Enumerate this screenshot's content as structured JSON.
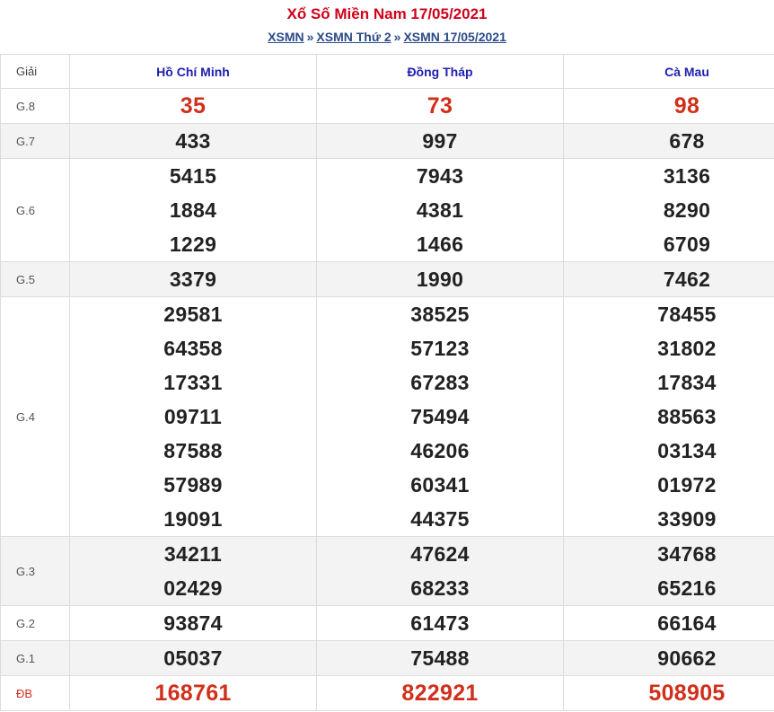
{
  "header": {
    "title": "Xổ Số Miền Nam 17/05/2021",
    "breadcrumb": [
      "XSMN",
      "XSMN Thứ 2",
      "XSMN 17/05/2021"
    ],
    "separator": "»"
  },
  "table": {
    "label_header": "Giải",
    "provinces": [
      "Hồ Chí Minh",
      "Đồng Tháp",
      "Cà Mau"
    ],
    "rows": [
      {
        "label": "G.8",
        "style": "red",
        "alt": false,
        "results": [
          [
            "35"
          ],
          [
            "73"
          ],
          [
            "98"
          ]
        ]
      },
      {
        "label": "G.7",
        "style": "normal",
        "alt": true,
        "results": [
          [
            "433"
          ],
          [
            "997"
          ],
          [
            "678"
          ]
        ]
      },
      {
        "label": "G.6",
        "style": "normal",
        "alt": false,
        "results": [
          [
            "5415",
            "1884",
            "1229"
          ],
          [
            "7943",
            "4381",
            "1466"
          ],
          [
            "3136",
            "8290",
            "6709"
          ]
        ]
      },
      {
        "label": "G.5",
        "style": "normal",
        "alt": true,
        "results": [
          [
            "3379"
          ],
          [
            "1990"
          ],
          [
            "7462"
          ]
        ]
      },
      {
        "label": "G.4",
        "style": "normal",
        "alt": false,
        "results": [
          [
            "29581",
            "64358",
            "17331",
            "09711",
            "87588",
            "57989",
            "19091"
          ],
          [
            "38525",
            "57123",
            "67283",
            "75494",
            "46206",
            "60341",
            "44375"
          ],
          [
            "78455",
            "31802",
            "17834",
            "88563",
            "03134",
            "01972",
            "33909"
          ]
        ]
      },
      {
        "label": "G.3",
        "style": "normal",
        "alt": true,
        "results": [
          [
            "34211",
            "02429"
          ],
          [
            "47624",
            "68233"
          ],
          [
            "34768",
            "65216"
          ]
        ]
      },
      {
        "label": "G.2",
        "style": "normal",
        "alt": false,
        "results": [
          [
            "93874"
          ],
          [
            "61473"
          ],
          [
            "66164"
          ]
        ]
      },
      {
        "label": "G.1",
        "style": "normal",
        "alt": true,
        "results": [
          [
            "05037"
          ],
          [
            "75488"
          ],
          [
            "90662"
          ]
        ]
      },
      {
        "label": "ĐB",
        "style": "red",
        "alt": false,
        "results": [
          [
            "168761"
          ],
          [
            "822921"
          ],
          [
            "508905"
          ]
        ]
      }
    ]
  }
}
